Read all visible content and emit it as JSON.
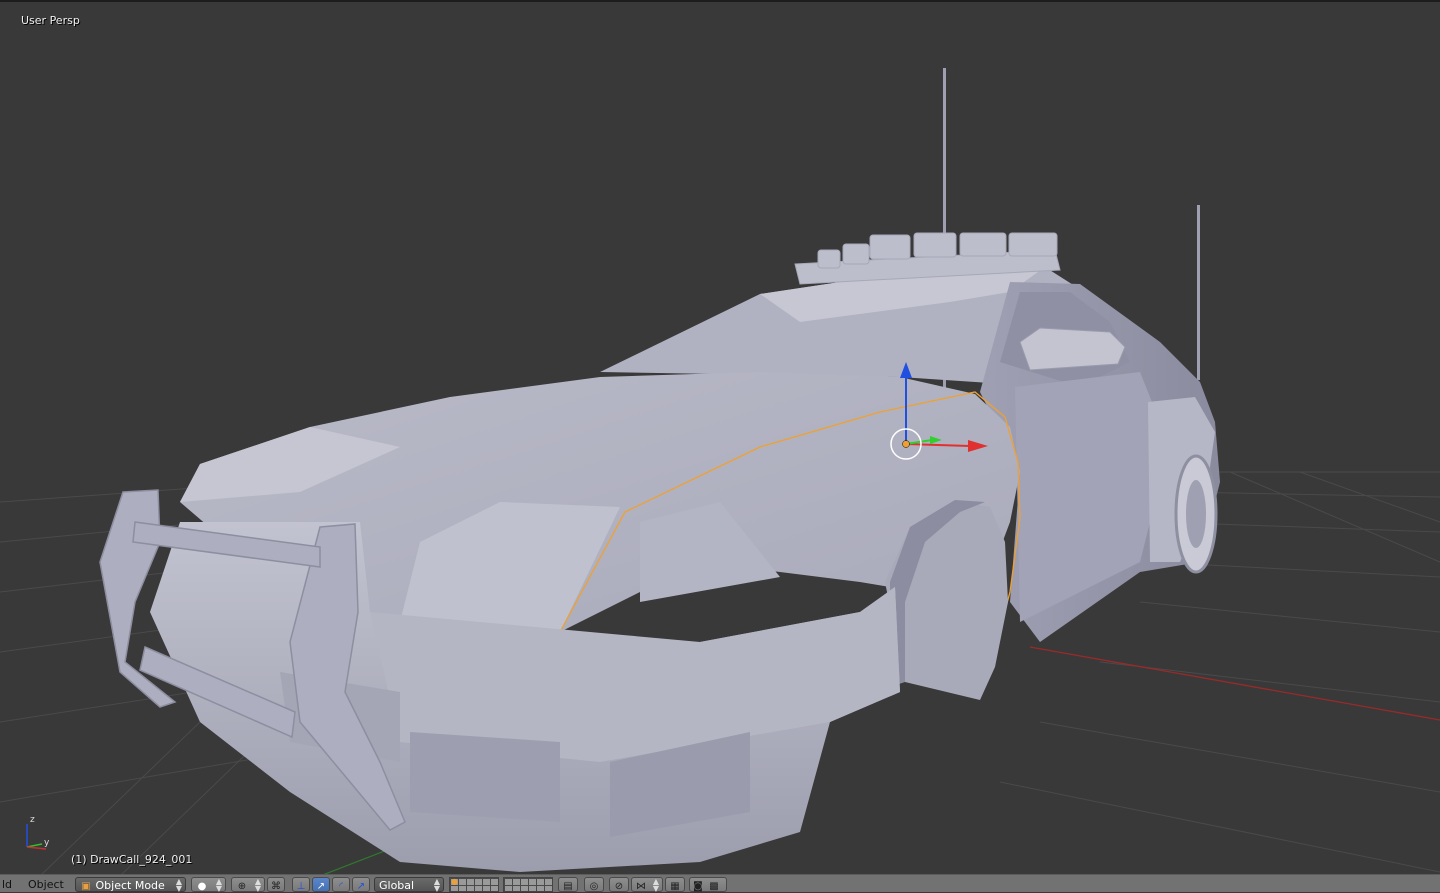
{
  "viewport": {
    "view_label": "User Persp",
    "object_label": "(1) DrawCall_924_001",
    "axis_labels": {
      "z": "z",
      "y": "y"
    }
  },
  "header": {
    "menu_view": "ld",
    "menu_object": "Object",
    "mode": "Object Mode",
    "orientation": "Global",
    "icons": [
      "cube-icon",
      "sphere-shading-icon",
      "pivot-icon",
      "manipulator-icon",
      "translate-icon",
      "rotate-icon",
      "scale-icon",
      "layers-icon",
      "lock-icon",
      "proportional-icon",
      "snap-icon",
      "snap-target-icon",
      "render-icon",
      "camera-icon"
    ]
  },
  "colors": {
    "viewport_bg": "#393939",
    "grid": "#4a4a4a",
    "x_axis": "#9a2a2a",
    "selection_outline": "#f0a030",
    "gizmo_x": "#e03030",
    "gizmo_y": "#30d030",
    "gizmo_z": "#2050e0",
    "car_body": "#b7b8c7"
  }
}
